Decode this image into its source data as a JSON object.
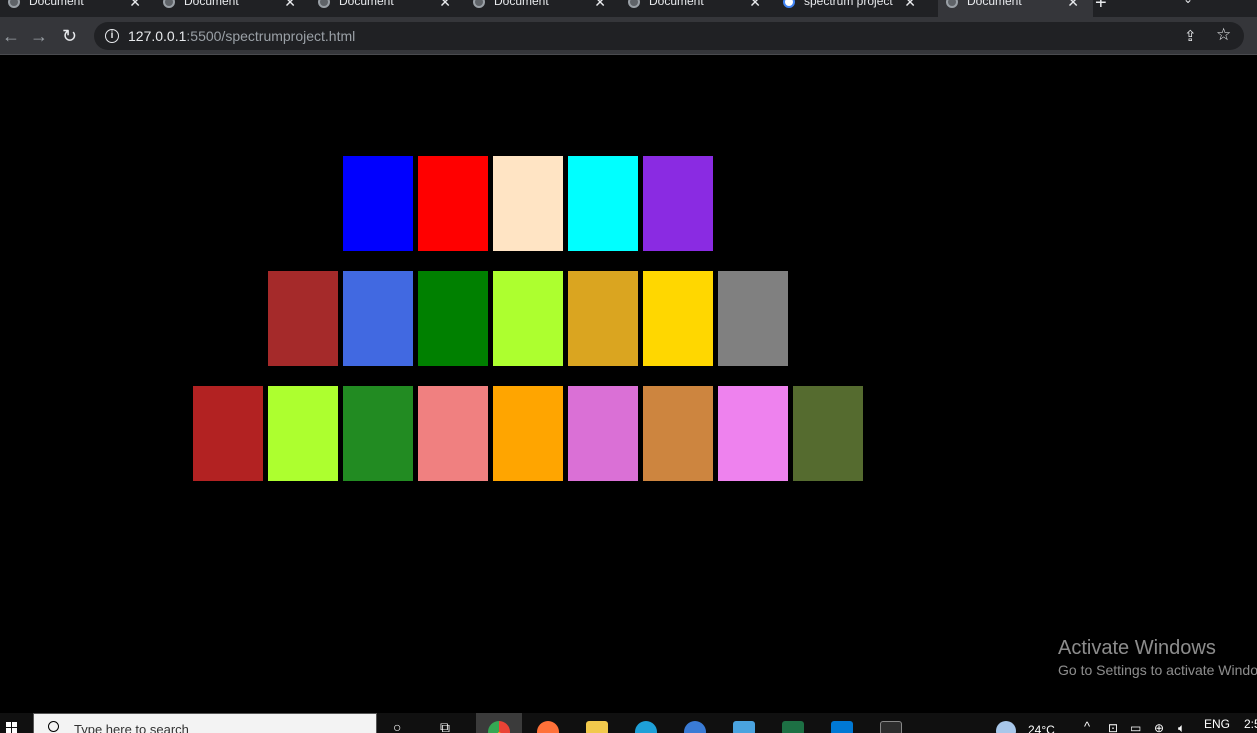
{
  "browser": {
    "tabs": [
      {
        "label": "Document",
        "icon": "globe-icon",
        "active": false
      },
      {
        "label": "Document",
        "icon": "globe-icon",
        "active": false
      },
      {
        "label": "Document",
        "icon": "globe-icon",
        "active": false
      },
      {
        "label": "Document",
        "icon": "globe-icon",
        "active": false
      },
      {
        "label": "Document",
        "icon": "globe-icon",
        "active": false
      },
      {
        "label": "spectrum project",
        "icon": "google-icon",
        "active": false
      },
      {
        "label": "Document",
        "icon": "globe-icon",
        "active": true
      }
    ],
    "close_glyph": "✕",
    "new_tab_glyph": "+",
    "tab_menu_glyph": "⌄",
    "url_host": "127.0.0.1",
    "url_path": ":5500/spectrumproject.html"
  },
  "spectrum": {
    "rows": [
      [
        "#0000ff",
        "#ff0000",
        "#ffe4c4",
        "#00ffff",
        "#8a2be2"
      ],
      [
        "#a52a2a",
        "#4169e1",
        "#008000",
        "#adff2f",
        "#daa520",
        "#ffd700",
        "#808080"
      ],
      [
        "#b22222",
        "#adff2f",
        "#228b22",
        "#f08080",
        "#ffa500",
        "#da70d6",
        "#cd853f",
        "#ee82ee",
        "#556b2f"
      ]
    ]
  },
  "watermark": {
    "title": "Activate Windows",
    "subtitle": "Go to Settings to activate Windows."
  },
  "taskbar": {
    "search_placeholder": "Type here to search",
    "temperature": "24°C",
    "language": "ENG",
    "clock": "2:5"
  }
}
